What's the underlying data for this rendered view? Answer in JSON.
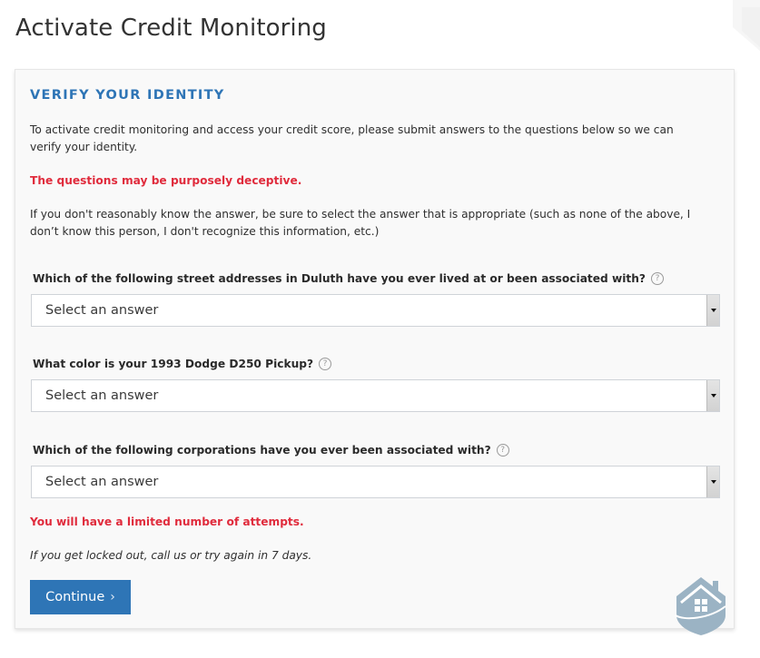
{
  "page": {
    "title": "Activate Credit Monitoring"
  },
  "card": {
    "section_title": "VERIFY YOUR IDENTITY",
    "intro": "To activate credit monitoring and access your credit score, please submit answers to the questions below so we can verify your identity.",
    "warning_deceptive": "The questions may be purposely deceptive.",
    "guidance": "If you don't reasonably know the answer, be sure to select the answer that is appropriate (such as none of the above, I don’t know this person, I don't recognize this information, etc.)",
    "questions": [
      {
        "label": "Which of the following street addresses in Duluth have you ever lived at or been associated with?",
        "help_icon": "question-circle-icon",
        "selected": "Select an answer"
      },
      {
        "label": "What color is your 1993 Dodge D250 Pickup?",
        "help_icon": "question-circle-icon",
        "selected": "Select an answer"
      },
      {
        "label": "Which of the following corporations have you ever been associated with?",
        "help_icon": "question-circle-icon",
        "selected": "Select an answer"
      }
    ],
    "warning_attempts": "You will have a limited number of attempts.",
    "lockout_note": "If you get locked out, call us or try again in 7 days.",
    "continue_label": "Continue",
    "continue_icon": "›",
    "help_glyph": "?"
  },
  "colors": {
    "accent": "#2e75b6",
    "warning": "#e02b3c",
    "logo": "#9bb3c4"
  }
}
